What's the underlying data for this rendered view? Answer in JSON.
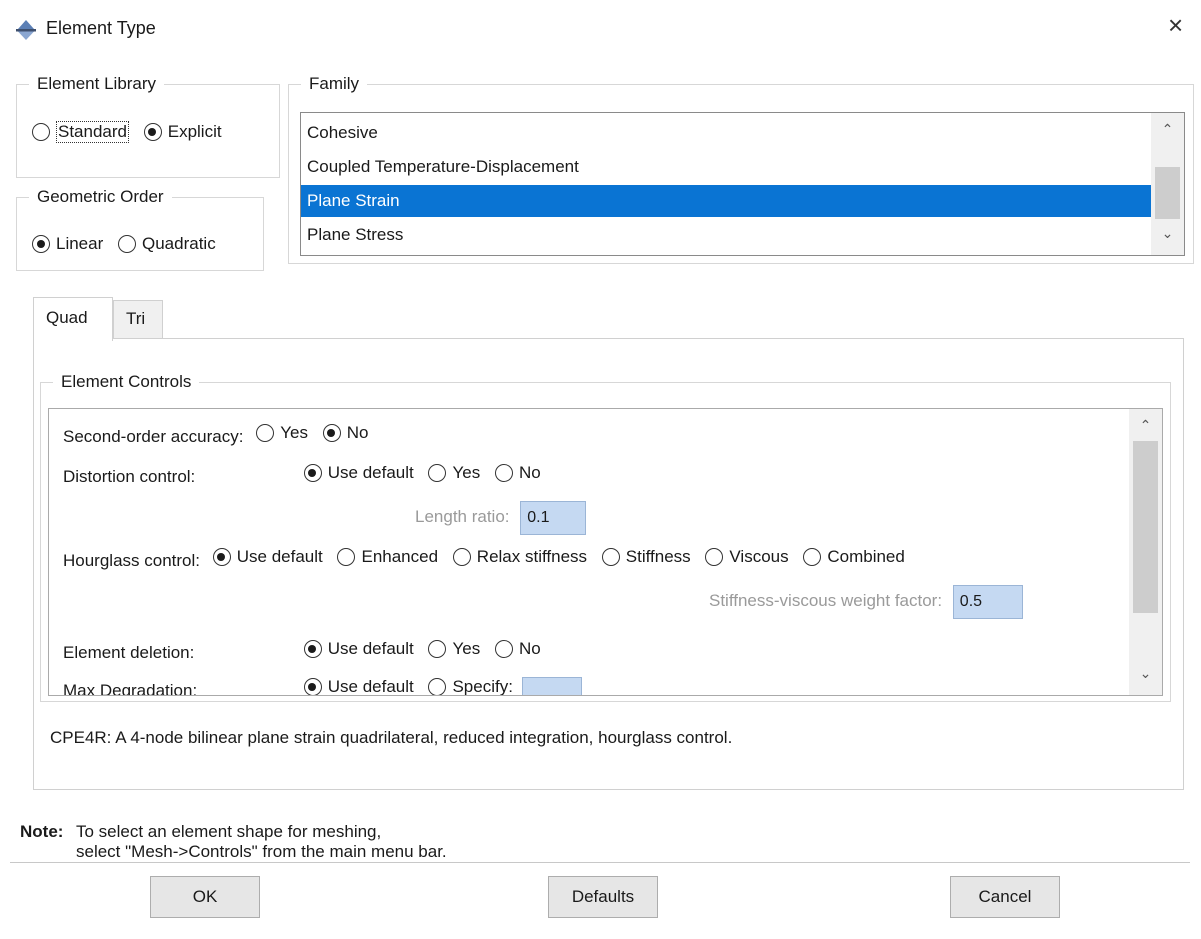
{
  "window": {
    "title": "Element Type",
    "close_glyph": "×"
  },
  "element_library": {
    "legend": "Element Library",
    "options": [
      {
        "label": "Standard",
        "selected": false
      },
      {
        "label": "Explicit",
        "selected": true
      }
    ]
  },
  "geometric_order": {
    "legend": "Geometric Order",
    "options": [
      {
        "label": "Linear",
        "selected": true
      },
      {
        "label": "Quadratic",
        "selected": false
      }
    ]
  },
  "family": {
    "legend": "Family",
    "items": [
      "Cohesive",
      "Coupled Temperature-Displacement",
      "Plane Strain",
      "Plane Stress"
    ],
    "selected": "Plane Strain",
    "scroll_up": "⌃",
    "scroll_down": "⌄"
  },
  "tabs": [
    {
      "label": "Quad",
      "active": true
    },
    {
      "label": "Tri",
      "active": false
    }
  ],
  "element_controls": {
    "legend": "Element Controls",
    "second_order": {
      "label": "Second-order accuracy:",
      "options": [
        {
          "label": "Yes",
          "selected": false
        },
        {
          "label": "No",
          "selected": true
        }
      ]
    },
    "distortion": {
      "label": "Distortion control:",
      "options": [
        {
          "label": "Use default",
          "selected": true
        },
        {
          "label": "Yes",
          "selected": false
        },
        {
          "label": "No",
          "selected": false
        }
      ]
    },
    "length_ratio": {
      "label": "Length ratio:",
      "value": "0.1"
    },
    "hourglass": {
      "label": "Hourglass control:",
      "options": [
        {
          "label": "Use default",
          "selected": true
        },
        {
          "label": "Enhanced",
          "selected": false
        },
        {
          "label": "Relax stiffness",
          "selected": false
        },
        {
          "label": "Stiffness",
          "selected": false
        },
        {
          "label": "Viscous",
          "selected": false
        },
        {
          "label": "Combined",
          "selected": false
        }
      ]
    },
    "weight_factor": {
      "label": "Stiffness-viscous weight factor:",
      "value": "0.5"
    },
    "deletion": {
      "label": "Element deletion:",
      "options": [
        {
          "label": "Use default",
          "selected": true
        },
        {
          "label": "Yes",
          "selected": false
        },
        {
          "label": "No",
          "selected": false
        }
      ]
    },
    "max_degradation": {
      "label": "Max Degradation:",
      "options": [
        {
          "label": "Use default",
          "selected": true
        },
        {
          "label": "Specify:",
          "selected": false
        }
      ]
    }
  },
  "description": "CPE4R:  A 4-node bilinear plane strain quadrilateral, reduced integration, hourglass control.",
  "note": {
    "label": "Note:",
    "line1": "To select an element shape for meshing,",
    "line2": "select \"Mesh->Controls\" from the main menu bar."
  },
  "buttons": {
    "ok": "OK",
    "defaults": "Defaults",
    "cancel": "Cancel"
  }
}
